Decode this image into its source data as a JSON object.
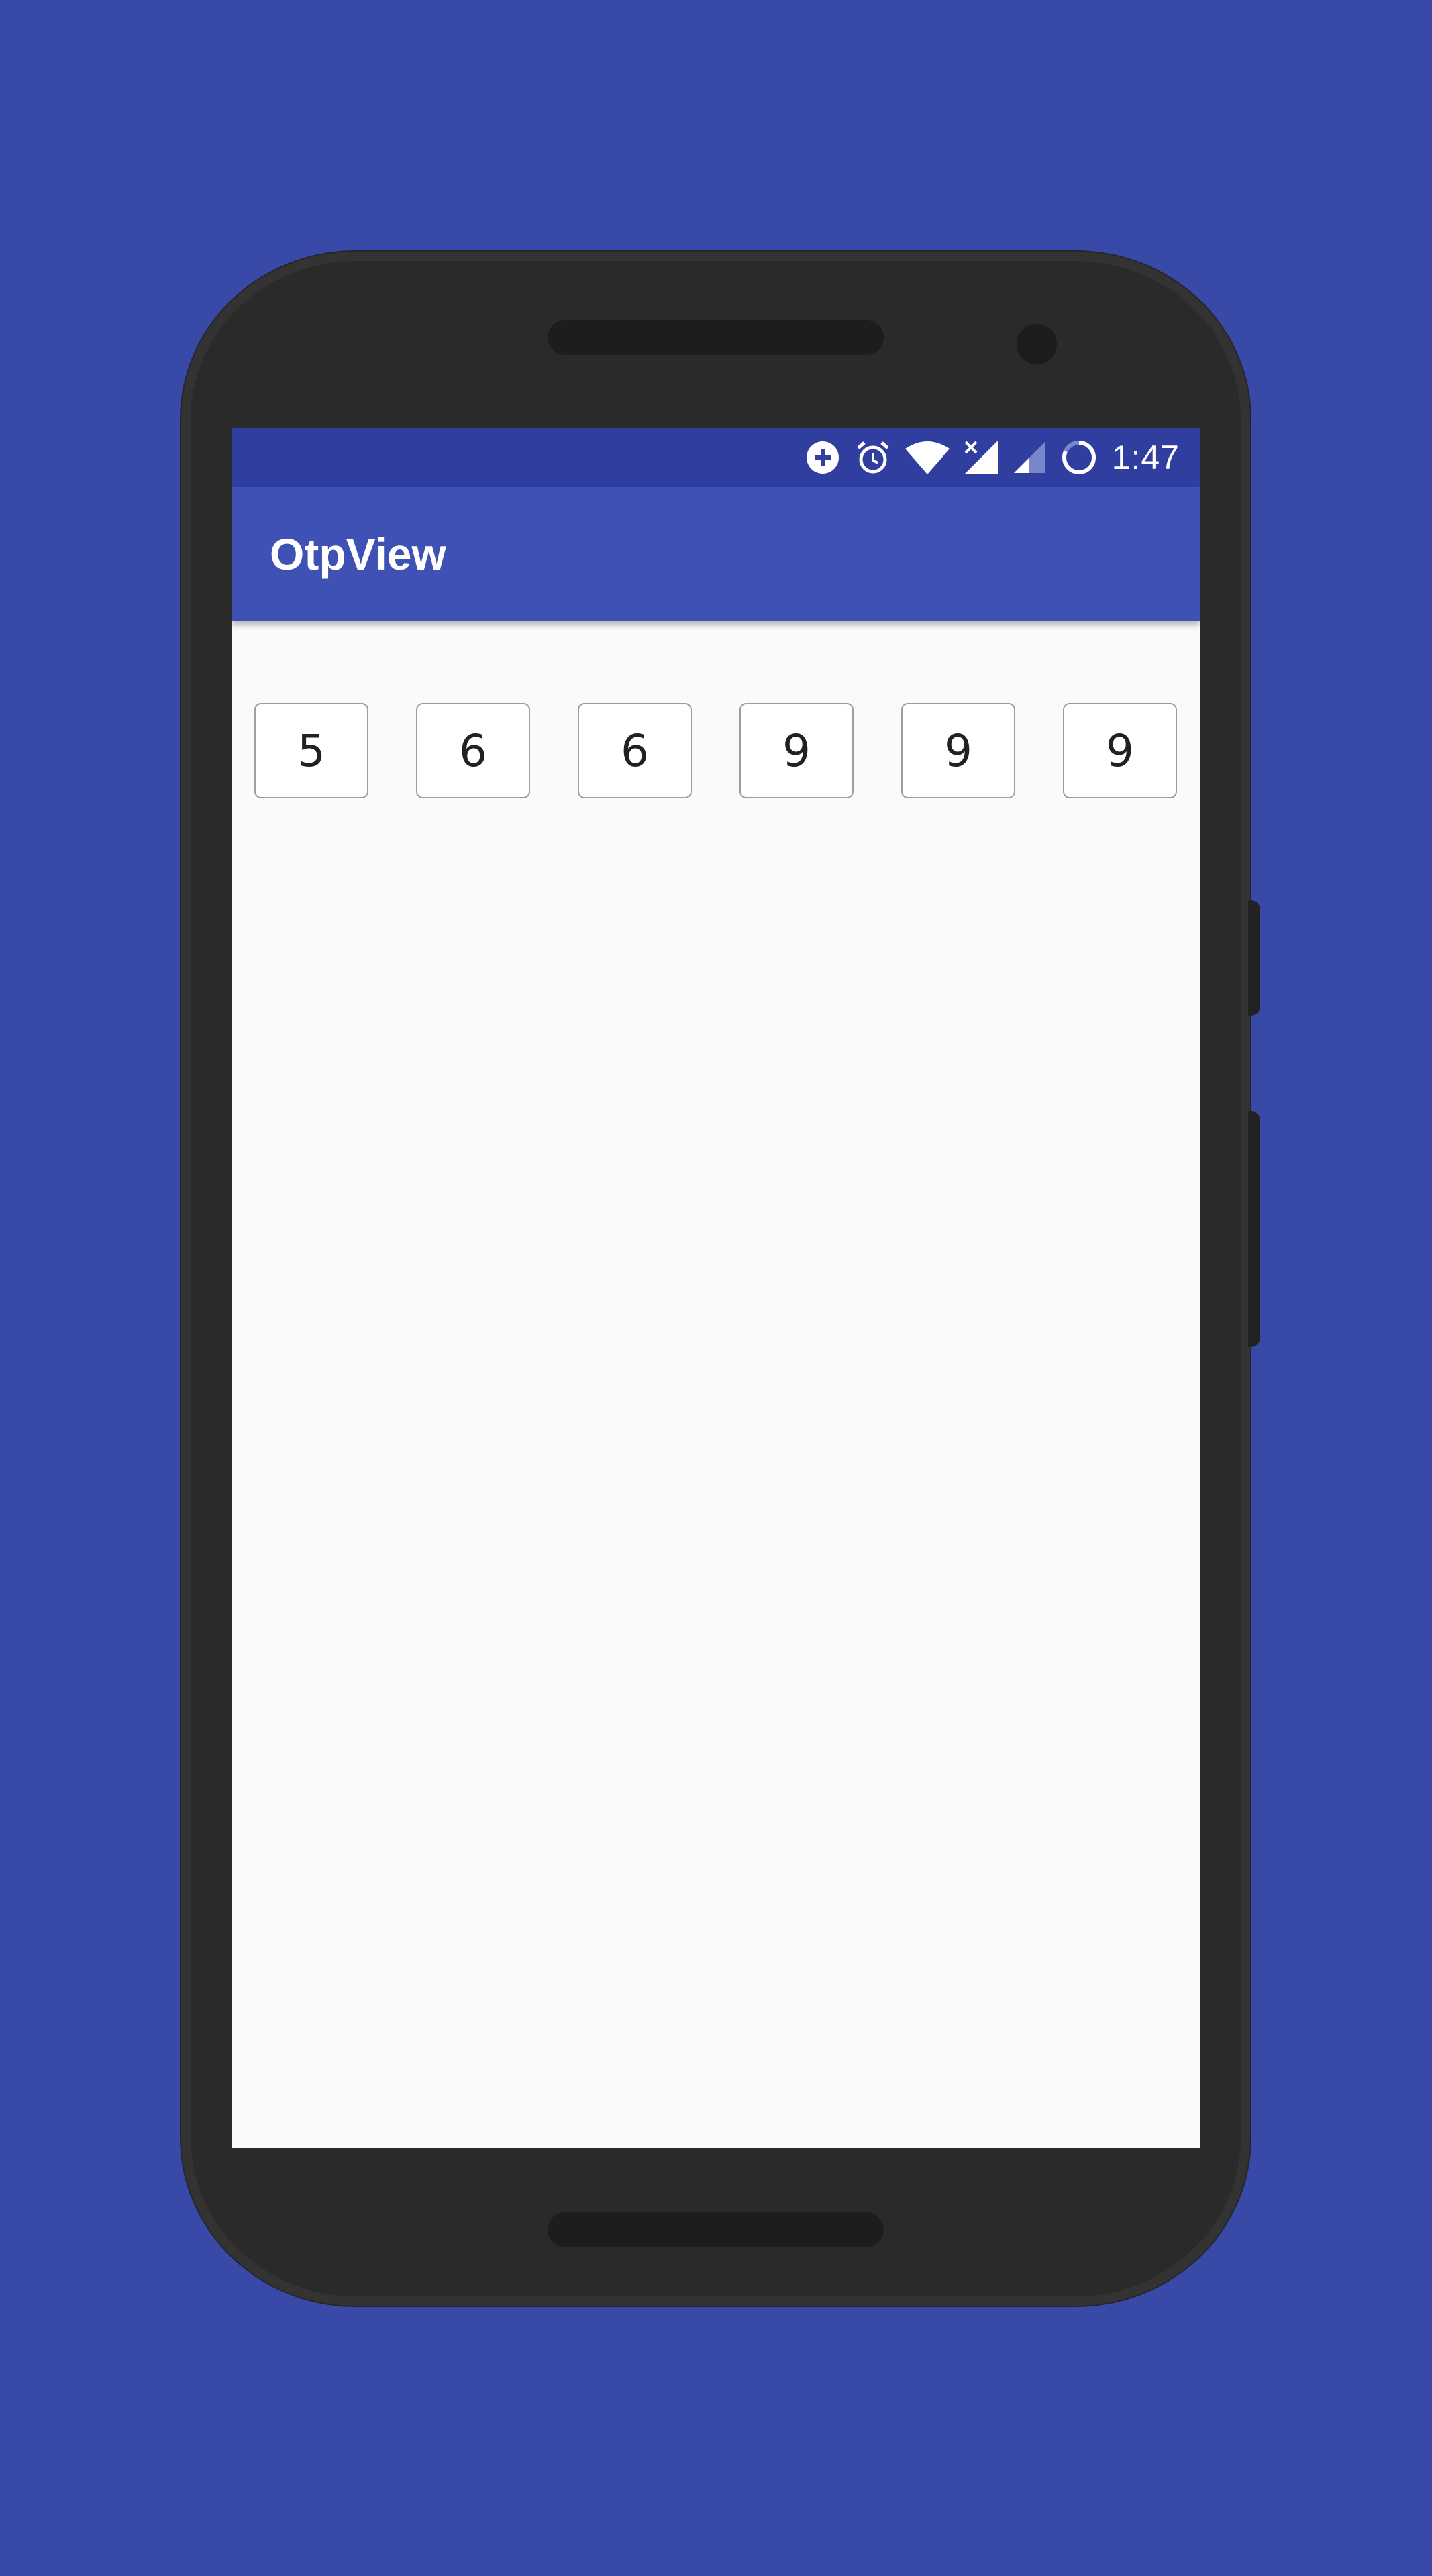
{
  "statusbar": {
    "time": "1:47",
    "icons": [
      "data-saver-icon",
      "alarm-icon",
      "wifi-icon",
      "signal-no-sim-icon",
      "signal-weak-icon",
      "battery-charging-icon"
    ]
  },
  "appbar": {
    "title": "OtpView"
  },
  "otp": {
    "digits": [
      "5",
      "6",
      "6",
      "9",
      "9",
      "9"
    ]
  },
  "colors": {
    "background": "#3949a8",
    "statusbar": "#303f9f",
    "appbar": "#3f51b5",
    "screen": "#fafafa"
  }
}
